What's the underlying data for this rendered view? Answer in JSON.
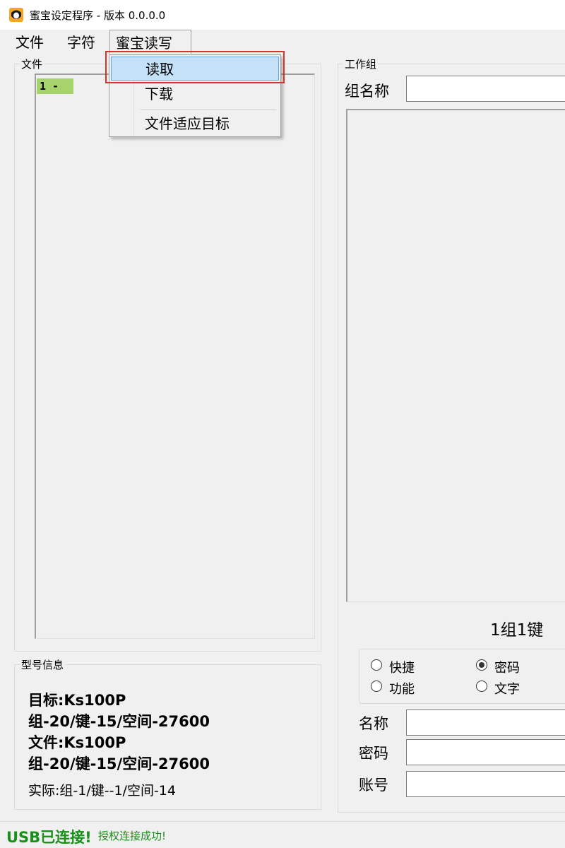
{
  "window": {
    "title": "蜜宝设定程序 - 版本 0.0.0.0",
    "icon": "app-logo-icon"
  },
  "menubar": {
    "items": [
      "文件",
      "字符",
      "蜜宝读写"
    ]
  },
  "dropdown": {
    "items": [
      "读取",
      "下载",
      "文件适应目标"
    ],
    "highlighted": "读取"
  },
  "file_panel": {
    "label": "文件",
    "list_items": [
      "1 -"
    ]
  },
  "model_info": {
    "label": "型号信息",
    "target": "目标:Ks100P",
    "target_spec": "组-20/键-15/空间-27600",
    "file": "文件:Ks100P",
    "file_spec": "组-20/键-15/空间-27600",
    "actual": "实际:组-1/键--1/空间-14"
  },
  "work_group": {
    "label": "工作组",
    "group_name_label": "组名称",
    "group_name_value": "",
    "key_count": "1组1键",
    "radio_options": [
      {
        "label": "快捷",
        "checked": false
      },
      {
        "label": "密码",
        "checked": true
      },
      {
        "label": "功能",
        "checked": false
      },
      {
        "label": "文字",
        "checked": false
      }
    ],
    "fields": [
      {
        "label": "名称",
        "value": ""
      },
      {
        "label": "密码",
        "value": ""
      },
      {
        "label": "账号",
        "value": ""
      }
    ]
  },
  "status": {
    "usb": "USB已连接!",
    "auth": "授权连接成功!",
    "usb_color": "#1a8f1a",
    "auth_color": "#1a8f1a"
  },
  "colors": {
    "highlight": "#c4e1f7",
    "annotation": "#d9322c",
    "list_item_bg": "#a6d36b"
  }
}
